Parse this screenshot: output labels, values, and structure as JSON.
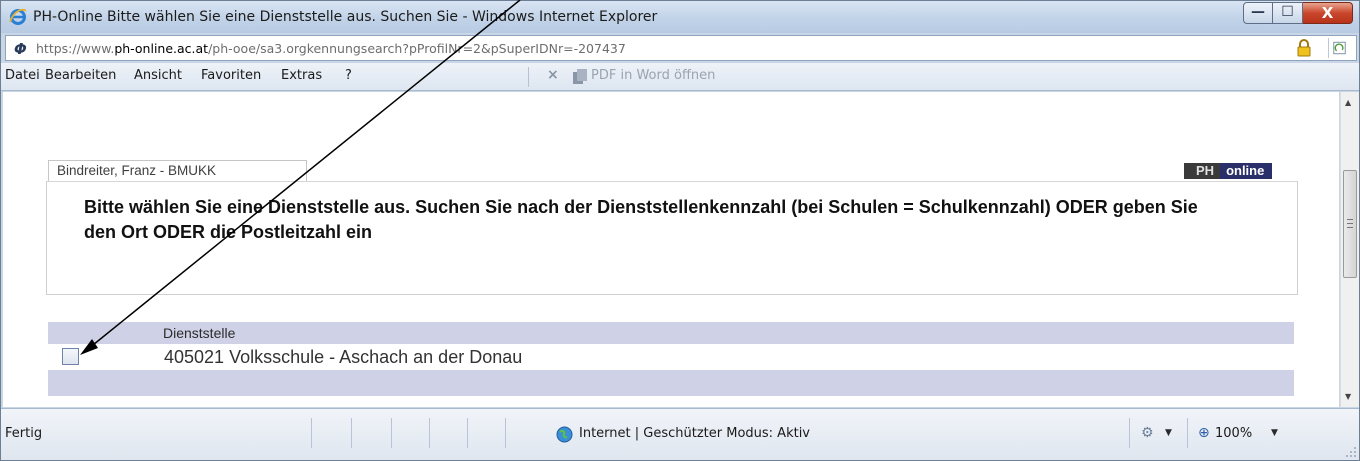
{
  "window": {
    "title": "PH-Online Bitte wählen Sie eine Dienststelle aus. Suchen Sie - Windows Internet Explorer",
    "buttons": {
      "minimize_glyph": "—",
      "maximize_glyph": "☐",
      "close_glyph": "X"
    }
  },
  "address": {
    "prefix": "https://www.",
    "domain": "ph-online.ac.at",
    "path": "/ph-ooe/sa3.orgkennungsearch?pProfilNr=2&pSuperIDNr=-207437"
  },
  "menu": {
    "items": [
      "Datei",
      "Bearbeiten",
      "Ansicht",
      "Favoriten",
      "Extras",
      "?"
    ],
    "pdf_close": "×",
    "pdf_label": "PDF in Word öffnen"
  },
  "page": {
    "user_tab": "Bindreiter, Franz - BMUKK",
    "logo_left": "PH",
    "logo_right": "online",
    "hint": "Bitte wählen Sie eine Dienststelle aus. Suchen Sie nach der Dienststellenkennzahl (bei Schulen = Schulkennzahl) ODER geben Sie den Ort ODER die Postleitzahl ein",
    "grid": {
      "header": "Dienststelle",
      "rows": [
        {
          "label": "405021 Volksschule - Aschach an der Donau",
          "checked": false
        }
      ]
    }
  },
  "status": {
    "text": "Fertig",
    "zone": "Internet | Geschützter Modus: Aktiv",
    "zoom": "100%",
    "dropdown_glyph": "▼"
  },
  "colors": {
    "grid_header_bg": "#cfd1e6",
    "logo_online_bg": "#2a2f6a",
    "close_button": "#c9472c"
  }
}
